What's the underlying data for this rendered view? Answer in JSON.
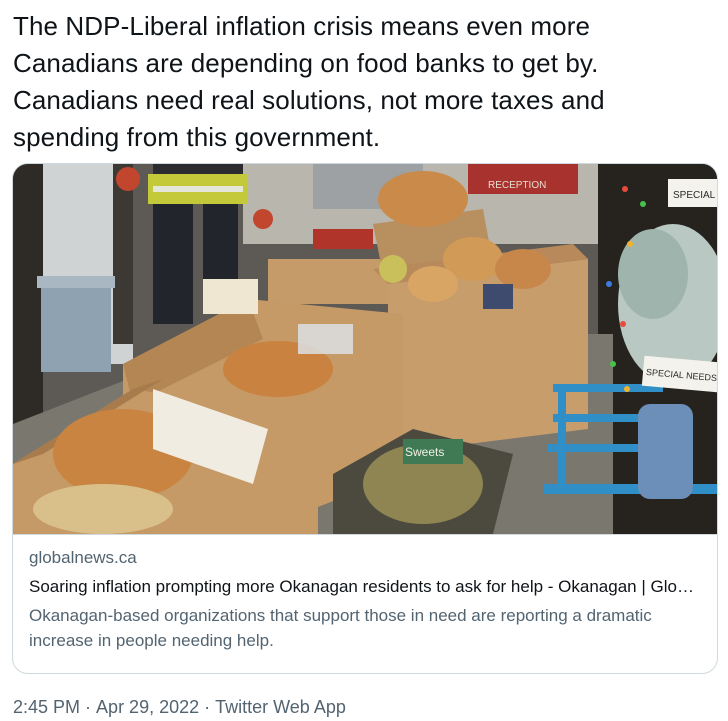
{
  "tweet": {
    "text": "The NDP-Liberal inflation crisis means even more Canadians are depending on food banks to get by. Canadians need real solutions, not more taxes and spending from this government."
  },
  "card": {
    "domain": "globalnews.ca",
    "title": "Soaring inflation prompting more Okanagan residents to ask for help - Okanagan | Globalnews.ca",
    "description": "Okanagan-based organizations that support those in need are reporting a dramatic increase in people needing help.",
    "image_sign_1": "SPECIAL N",
    "image_sign_2": "SPECIAL NEEDS",
    "image_sign_3": "RECEPTION",
    "image_box_label": "Sweets"
  },
  "meta": {
    "time": "2:45 PM",
    "separator": "·",
    "date": "Apr 29, 2022",
    "source": "Twitter Web App"
  }
}
